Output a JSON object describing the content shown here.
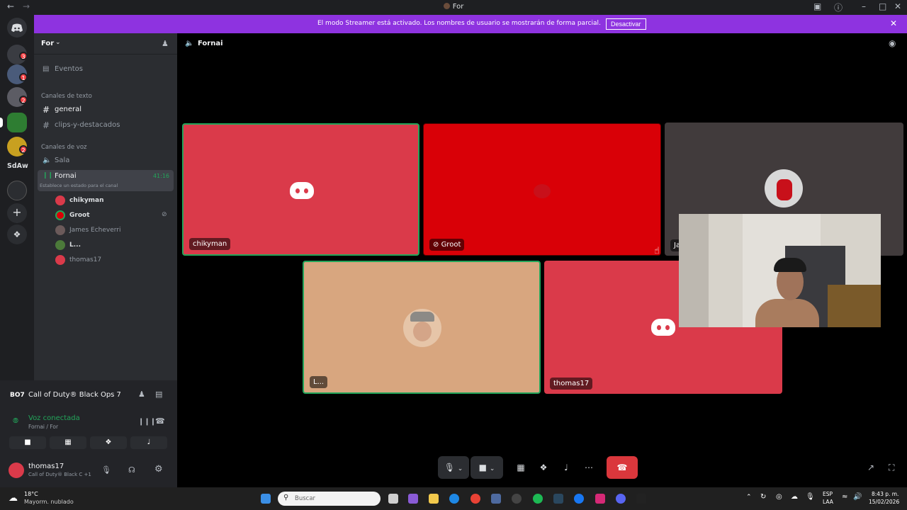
{
  "window": {
    "title": "For"
  },
  "banner": {
    "text": "El modo Streamer está activado. Los nombres de usuario se mostrarán de forma parcial.",
    "button": "Desactivar"
  },
  "rail": {
    "label_sdaw": "SdAw",
    "badges": [
      "3",
      "1",
      "2",
      "2"
    ]
  },
  "server": {
    "name": "For"
  },
  "sidebar": {
    "events": "Eventos",
    "text_category": "Canales de texto",
    "text_channels": [
      "general",
      "clips-y-destacados"
    ],
    "voice_category": "Canales de voz",
    "voice_channels": [
      "Sala",
      "Fornai"
    ],
    "fornai_time": "41:16",
    "fornai_status": "Establece un estado para el canal",
    "voice_users": [
      "chikyman",
      "Groot",
      "James Echeverri",
      "L...",
      "thomas17"
    ]
  },
  "activity": {
    "game": "Call of Duty® Black Ops 7"
  },
  "voice_status": {
    "label": "Voz conectada",
    "location": "Fornai / For"
  },
  "user": {
    "name": "thomas17",
    "status": "Call of Duty® Black C +1"
  },
  "main": {
    "channel_title": "Fornai",
    "tiles": [
      {
        "name": "chikyman",
        "color": "#da3a4a"
      },
      {
        "name": "Groot",
        "color": "#d90007"
      },
      {
        "name": "Ja",
        "color": "#413b3c"
      },
      {
        "name": "L...",
        "color": "#d8a67f"
      },
      {
        "name": "thomas17",
        "color": "#da3a4a"
      }
    ]
  },
  "taskbar": {
    "weather_temp": "18°C",
    "weather_desc": "Mayorm. nublado",
    "search_placeholder": "Buscar",
    "lang": "ESP",
    "lang2": "LAA",
    "time": "8:43 p. m.",
    "date": "15/02/2026"
  },
  "colors": {
    "accent": "#8e33e0",
    "green": "#23a55a",
    "red": "#da373c"
  }
}
